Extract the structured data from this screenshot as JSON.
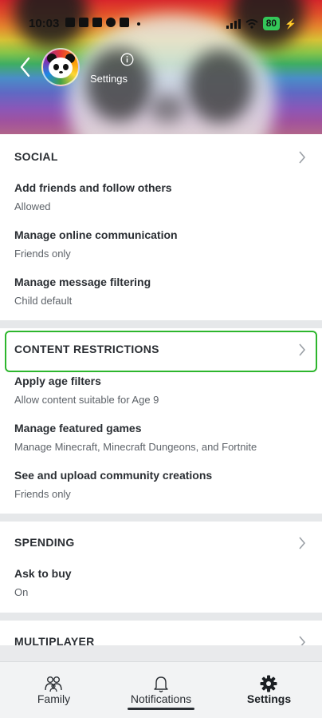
{
  "status_bar": {
    "time": "10:03",
    "battery": "80"
  },
  "header": {
    "subtitle": "Settings"
  },
  "social": {
    "title": "SOCIAL",
    "items": [
      {
        "label": "Add friends and follow others",
        "value": "Allowed"
      },
      {
        "label": "Manage online communication",
        "value": "Friends only"
      },
      {
        "label": "Manage message filtering",
        "value": "Child default"
      }
    ]
  },
  "content_restrictions": {
    "title": "CONTENT RESTRICTIONS",
    "items": [
      {
        "label": "Apply age filters",
        "value": "Allow content suitable for Age 9"
      },
      {
        "label": "Manage featured games",
        "value": "Manage Minecraft, Minecraft Dungeons, and Fortnite"
      },
      {
        "label": "See and upload community creations",
        "value": "Friends only"
      }
    ]
  },
  "spending": {
    "title": "SPENDING",
    "items": [
      {
        "label": "Ask to buy",
        "value": "On"
      }
    ]
  },
  "multiplayer": {
    "title": "MULTIPLAYER"
  },
  "bottom_nav": {
    "items": [
      {
        "label": "Family",
        "icon": "family-icon"
      },
      {
        "label": "Notifications",
        "icon": "bell-icon"
      },
      {
        "label": "Settings",
        "icon": "gear-icon",
        "active": true
      }
    ]
  },
  "colors": {
    "highlight": "#2db62d",
    "battery": "#34c759",
    "divider": "#e6e8ea"
  }
}
